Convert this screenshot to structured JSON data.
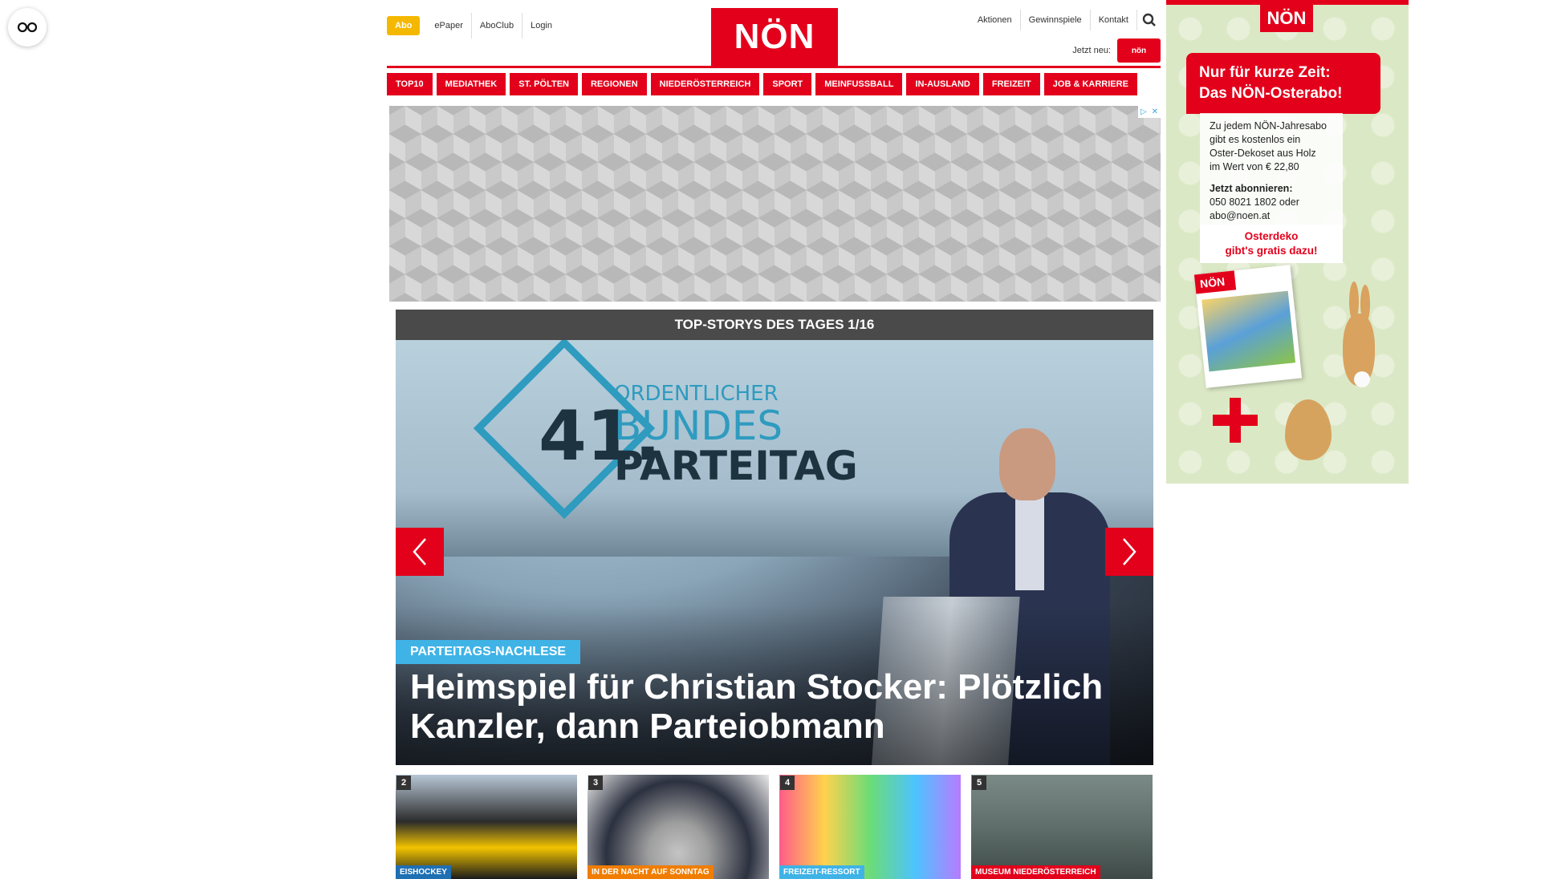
{
  "header": {
    "abo_label": "Abo",
    "top_links": [
      "ePaper",
      "AboClub",
      "Login"
    ],
    "logo_text": "NÖN",
    "right_links": [
      "Aktionen",
      "Gewinnspiele",
      "Kontakt"
    ],
    "jetzt_neu_label": "Jetzt neu:",
    "badge_text": "nön"
  },
  "categories": [
    "TOP10",
    "MEDIATHEK",
    "ST. PÖLTEN",
    "REGIONEN",
    "NIEDERÖSTERREICH",
    "SPORT",
    "MEINFUSSBALL",
    "IN-AUSLAND",
    "FREIZEIT",
    "JOB & KARRIERE"
  ],
  "stories": {
    "header": "TOP-STORYS DES TAGES 1/16",
    "hero": {
      "tag": "PARTEITAGS-NACHLESE",
      "title": "Heimspiel für Christian Stocker: Plötzlich Kanzler, dann Parteiobmann",
      "screen_number": "41.",
      "screen_line1": "ORDENTLICHER",
      "screen_line2": "BUNDES",
      "screen_line3": "PARTEITAG"
    },
    "thumbs": [
      {
        "num": "2",
        "tag": "EISHOCKEY",
        "tag_color": "#1f6fb3"
      },
      {
        "num": "3",
        "tag": "IN DER NACHT AUF SONNTAG",
        "tag_color": "#f07d00"
      },
      {
        "num": "4",
        "tag": "FREIZEIT-RESSORT",
        "tag_color": "#3fb3e6"
      },
      {
        "num": "5",
        "tag": "MUSEUM NIEDERÖSTERREICH",
        "tag_color": "#e3001b"
      }
    ]
  },
  "side_ad": {
    "logo": "NÖN",
    "headline_1": "Nur für kurze Zeit:",
    "headline_2": "Das NÖN-Osterabo!",
    "body_1": "Zu jedem NÖN-Jahresabo",
    "body_2": "gibt es kostenlos ein",
    "body_3": "Oster-Dekoset aus Holz",
    "body_4": "im Wert von € 22,80",
    "cta_title": "Jetzt abonnieren:",
    "cta_phone": "050 8021 1802 oder",
    "cta_email": "abo@noen.at",
    "osterdeko_1": "Osterdeko",
    "osterdeko_2": "gibt's gratis dazu!",
    "mag_logo": "NÖN"
  },
  "colors": {
    "brand_red": "#e3001b",
    "abo_yellow": "#f5b800",
    "tag_blue": "#3fb3e6",
    "story_header": "#4a4a4a"
  }
}
